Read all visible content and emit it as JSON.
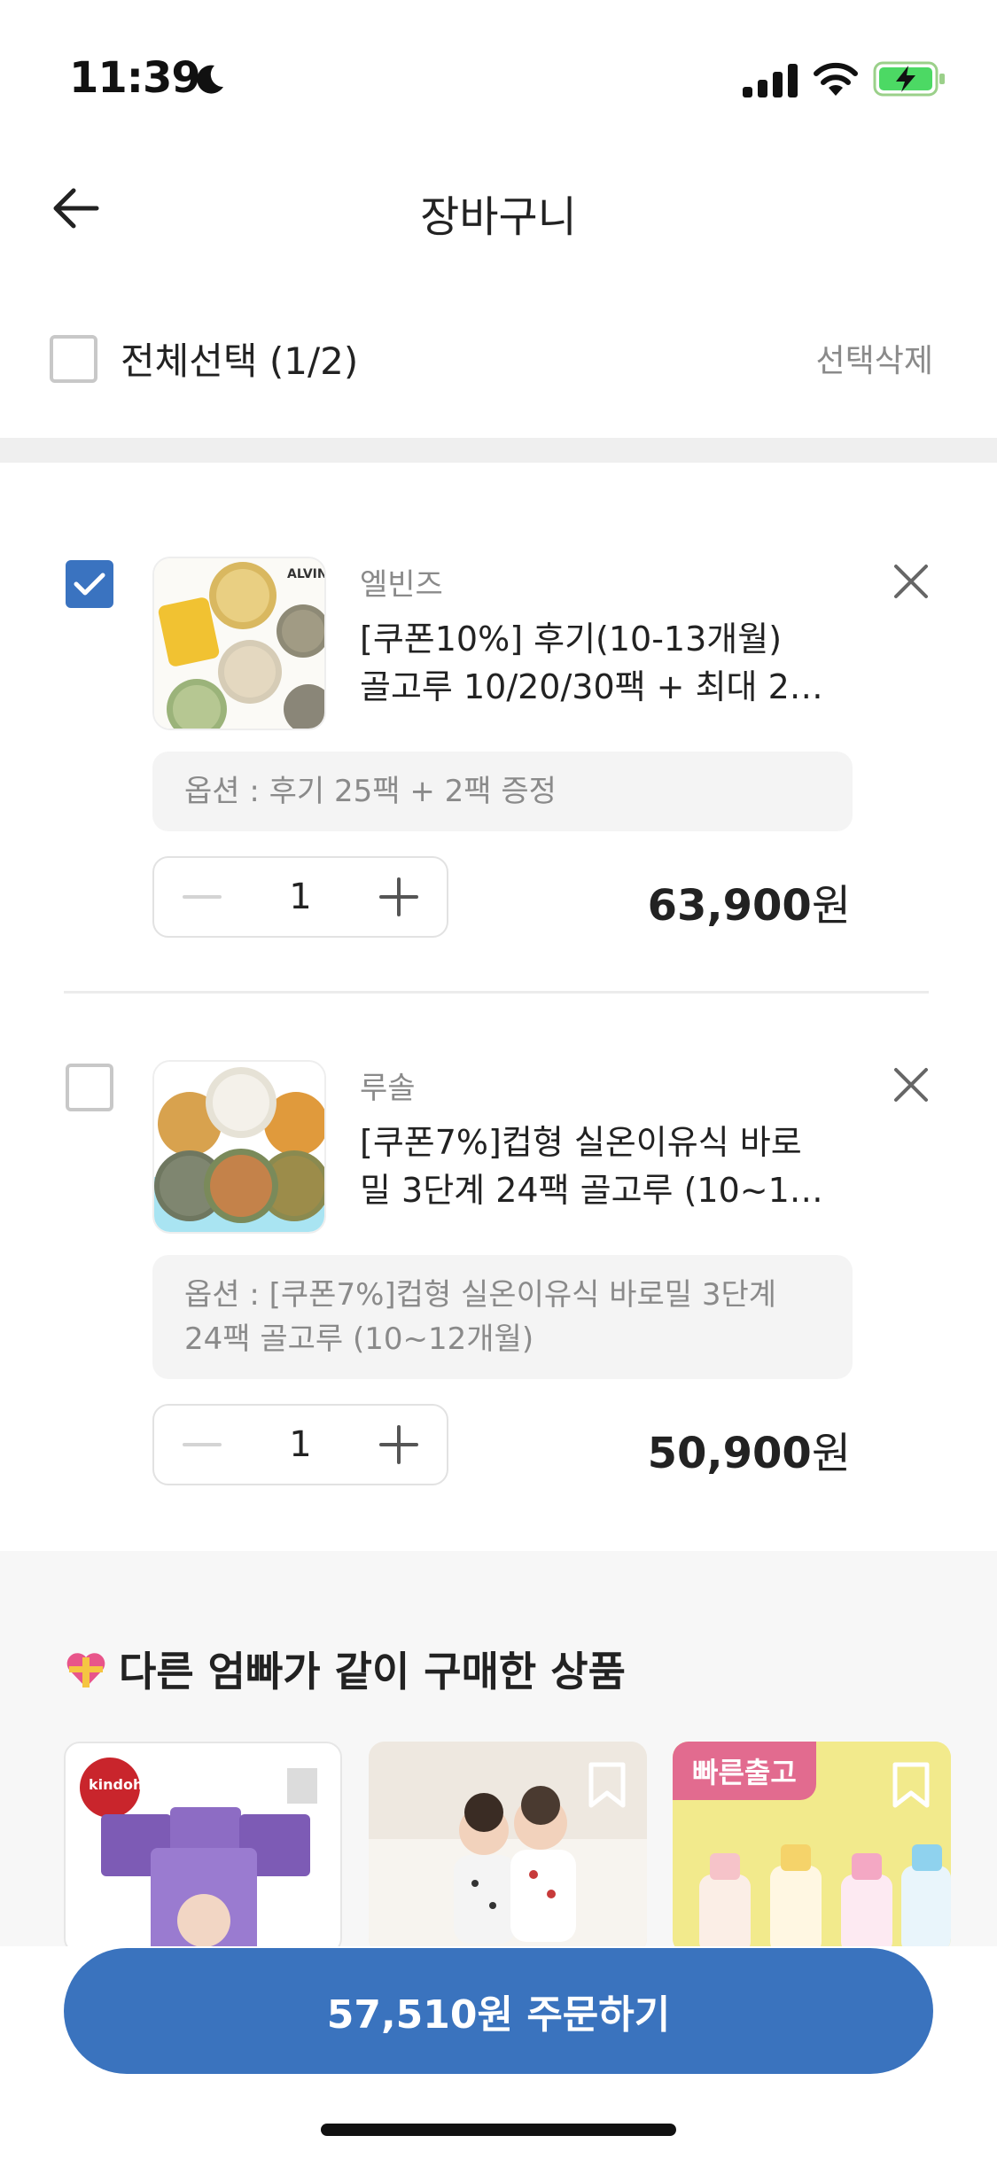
{
  "status_bar": {
    "time": "11:39"
  },
  "header": {
    "title": "장바구니"
  },
  "selection": {
    "select_all_label": "전체선택 (1/2)",
    "delete_selected_label": "선택삭제"
  },
  "cart_items": [
    {
      "checked": true,
      "brand": "엘빈즈",
      "title_line1": "[쿠폰10%] 후기(10-13개월)",
      "title_line2": "골고루 10/20/30팩 + 최대 2…",
      "option_text": "옵션 : 후기 25팩 + 2팩 증정",
      "quantity": "1",
      "price_number": "63,900",
      "price_unit": "원"
    },
    {
      "checked": false,
      "brand": "루솔",
      "title_line1": "[쿠폰7%]컵형 실온이유식 바로",
      "title_line2": "밀 3단계 24팩 골고루 (10~1…",
      "option_text": "옵션 : [쿠폰7%]컵형 실온이유식 바로밀 3단계 24팩 골고루 (10~12개월)",
      "quantity": "1",
      "price_number": "50,900",
      "price_unit": "원"
    }
  ],
  "recommendations": {
    "title": "다른 엄빠가 같이 구매한 상품",
    "items": [
      {
        "image": "kindoh-diaper-product",
        "badge": ""
      },
      {
        "image": "baby-clothing-photo",
        "badge": ""
      },
      {
        "image": "baby-bottle-set",
        "badge": "빠른출고"
      }
    ]
  },
  "order_button": {
    "label": "57,510원 주문하기"
  },
  "colors": {
    "accent": "#3a73be",
    "checkbox_checked": "#3a73c0",
    "badge": "#e26b8f"
  }
}
